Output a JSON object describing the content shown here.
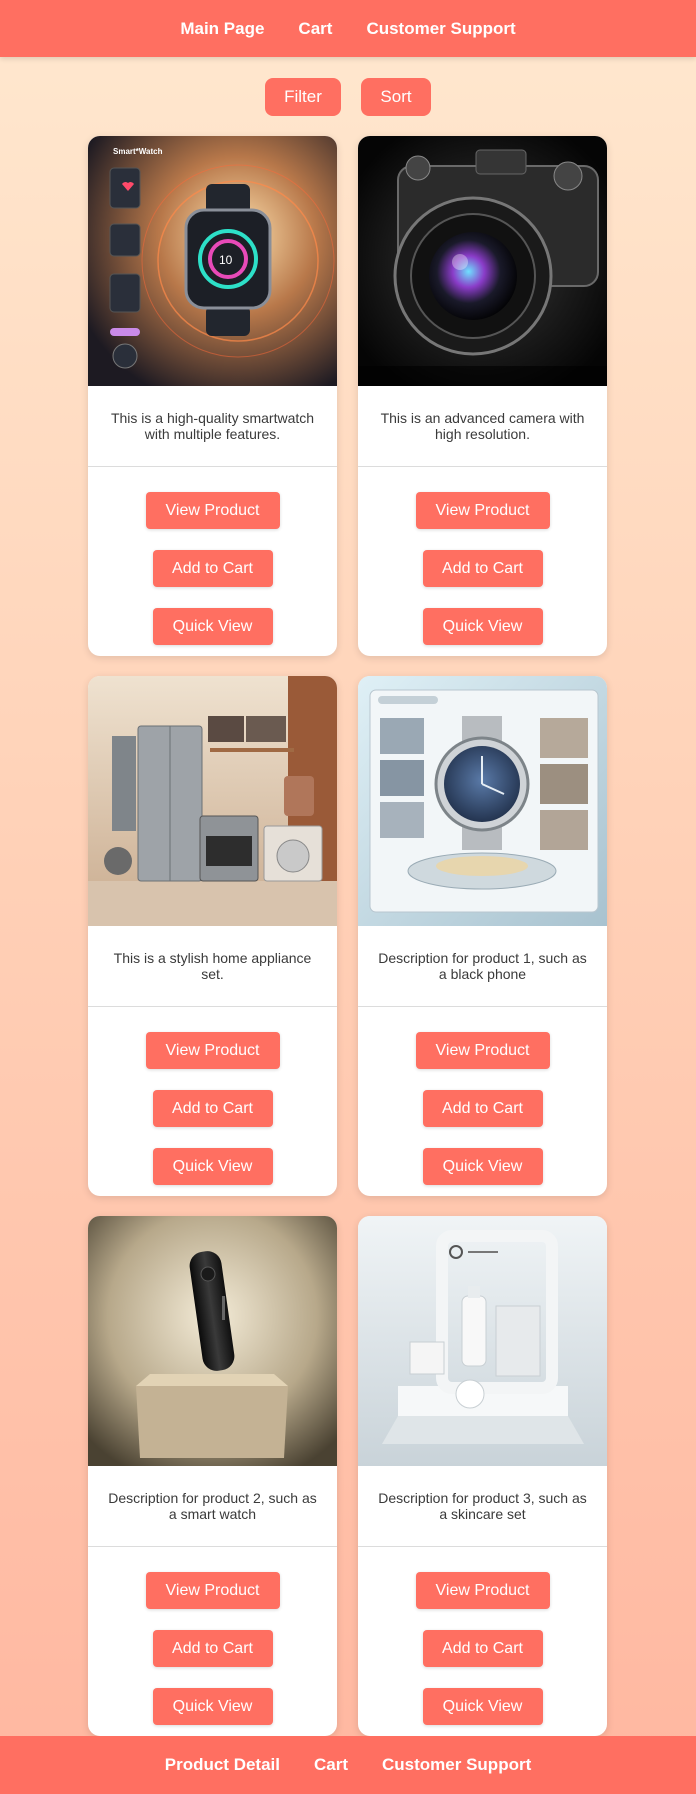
{
  "topnav": {
    "items": [
      "Main Page",
      "Cart",
      "Customer Support"
    ]
  },
  "toolbar": {
    "filter_label": "Filter",
    "sort_label": "Sort"
  },
  "products": [
    {
      "image_subject": "smartwatch",
      "image_text": "Smart*Watch",
      "description": "This is a high-quality smartwatch with multiple features.",
      "view_label": "View Product",
      "add_label": "Add to Cart",
      "quick_label": "Quick View"
    },
    {
      "image_subject": "camera",
      "description": "This is an advanced camera with high resolution.",
      "view_label": "View Product",
      "add_label": "Add to Cart",
      "quick_label": "Quick View"
    },
    {
      "image_subject": "home-appliances",
      "description": "This is a stylish home appliance set.",
      "view_label": "View Product",
      "add_label": "Add to Cart",
      "quick_label": "Quick View"
    },
    {
      "image_subject": "watch-showcase",
      "description": "Description for product 1, such as a black phone",
      "view_label": "View Product",
      "add_label": "Add to Cart",
      "quick_label": "Quick View"
    },
    {
      "image_subject": "black-device",
      "description": "Description for product 2, such as a smart watch",
      "view_label": "View Product",
      "add_label": "Add to Cart",
      "quick_label": "Quick View"
    },
    {
      "image_subject": "skincare-set",
      "description": "Description for product 3, such as a skincare set",
      "view_label": "View Product",
      "add_label": "Add to Cart",
      "quick_label": "Quick View"
    }
  ],
  "bottomnav": {
    "items": [
      "Product Detail",
      "Cart",
      "Customer Support"
    ]
  },
  "colors": {
    "accent": "#ff6f61",
    "background_top": "#ffe8cf",
    "background_bottom": "#ffb7a0"
  }
}
